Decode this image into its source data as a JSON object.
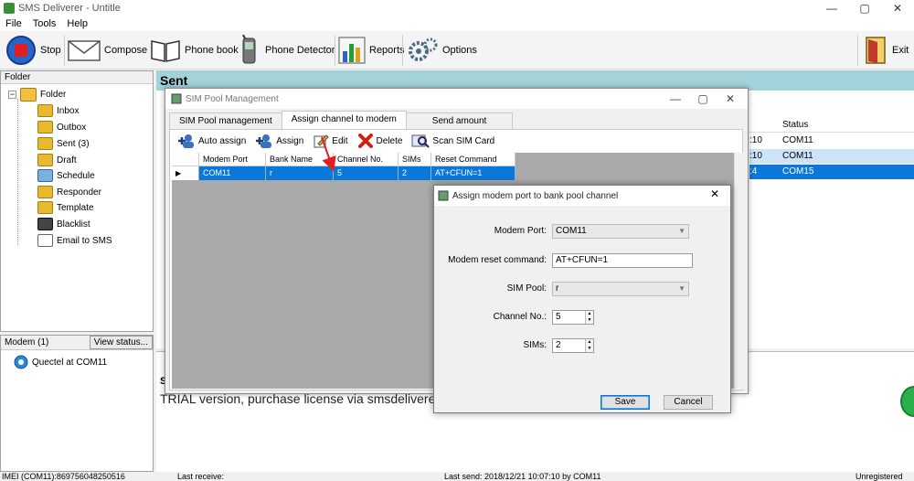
{
  "app": {
    "title": "SMS Deliverer - Untitle",
    "window_controls": [
      "—",
      "▢",
      "✕"
    ]
  },
  "menu": [
    "File",
    "Tools",
    "Help"
  ],
  "toolbar": {
    "stop": "Stop",
    "compose": "Compose",
    "phone_book": "Phone book",
    "phone_detector": "Phone Detector",
    "reports": "Reports",
    "options": "Options",
    "exit": "Exit"
  },
  "folder_pane": {
    "header": "Folder",
    "root": "Folder",
    "items": [
      "Inbox",
      "Outbox",
      "Sent (3)",
      "Draft",
      "Schedule",
      "Responder",
      "Template",
      "Blacklist",
      "Email to SMS"
    ]
  },
  "modem_pane": {
    "header": "Modem (1)",
    "view_button": "View status...",
    "modem": "Quectel at COM11"
  },
  "sent": {
    "title": "Sent",
    "status_header": "Status",
    "rows": [
      {
        "time": ":10",
        "status": "COM11"
      },
      {
        "time": ":10",
        "status": "COM11"
      },
      {
        "time": ":4",
        "status": "COM15"
      }
    ],
    "lower_label": "S",
    "trial_text": "TRIAL version, purchase license via smsdeliverer."
  },
  "statusbar": {
    "imei": "IMEI (COM11):869756048250516",
    "last_receive": "Last receive:",
    "last_send": "Last send: 2018/12/21 10:07:10 by COM11",
    "registration": "Unregistered"
  },
  "sim_pool": {
    "title": "SIM Pool Management",
    "tabs": [
      "SIM Pool management",
      "Assign channel to modem",
      "Send amount"
    ],
    "active_tab": 1,
    "toolbar": {
      "auto_assign": "Auto assign",
      "assign": "Assign",
      "edit": "Edit",
      "delete": "Delete",
      "scan": "Scan SIM Card"
    },
    "columns": [
      "Modem Port",
      "Bank Name",
      "Channel No.",
      "SIMs",
      "Reset Command"
    ],
    "rows": [
      {
        "modem_port": "COM11",
        "bank_name": "r",
        "channel": "5",
        "sims": "2",
        "reset": "AT+CFUN=1"
      }
    ]
  },
  "dialog": {
    "title": "Assign modem port to bank pool channel",
    "modem_port_label": "Modem Port:",
    "modem_port_value": "COM11",
    "reset_label": "Modem reset command:",
    "reset_value": "AT+CFUN=1",
    "sim_pool_label": "SIM Pool:",
    "sim_pool_value": "r",
    "channel_label": "Channel No.:",
    "channel_value": "5",
    "sims_label": "SIMs:",
    "sims_value": "2",
    "save": "Save",
    "cancel": "Cancel"
  },
  "colors": {
    "selection_blue": "#0b78d7",
    "sent_header": "#a3d3da",
    "annotation_red": "#e02020"
  }
}
